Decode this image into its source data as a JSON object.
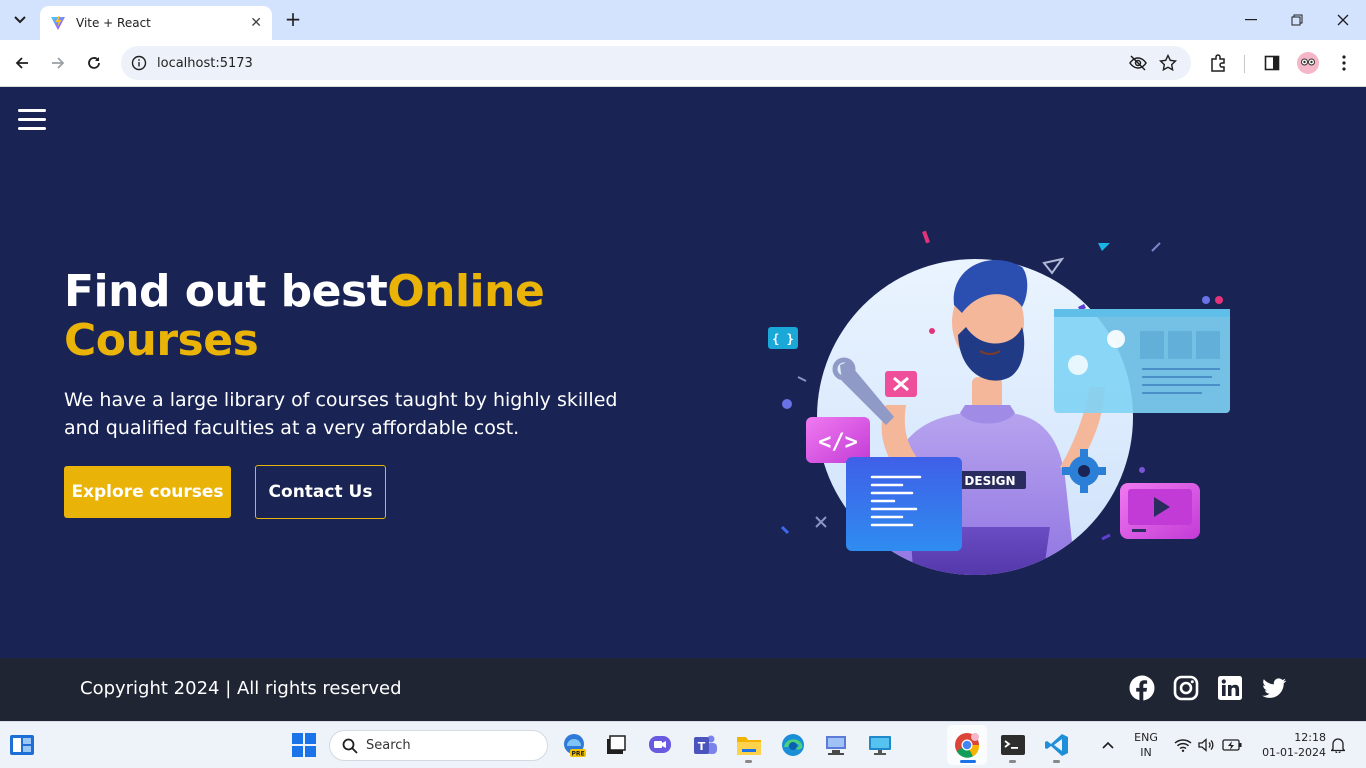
{
  "browser": {
    "tab_title": "Vite + React",
    "url": "localhost:5173",
    "tab_icon": "vite-logo-icon"
  },
  "hero": {
    "title_part1": "Find out best",
    "title_accent": "Online Courses",
    "description": "We have a large library of courses taught by highly skilled and qualified faculties at a very affordable cost.",
    "primary_button": "Explore courses",
    "secondary_button": "Contact Us",
    "illustration_badge": "DESIGN"
  },
  "footer": {
    "copyright": "Copyright 2024 | All rights reserved",
    "social_icons": [
      "facebook-icon",
      "instagram-icon",
      "linkedin-icon",
      "twitter-icon"
    ]
  },
  "taskbar": {
    "search_label": "Search",
    "language_line1": "ENG",
    "language_line2": "IN",
    "time": "12:18",
    "date": "01-01-2024"
  },
  "colors": {
    "page_background": "#192454",
    "accent": "#eab308",
    "footer_background": "#1f2532"
  }
}
